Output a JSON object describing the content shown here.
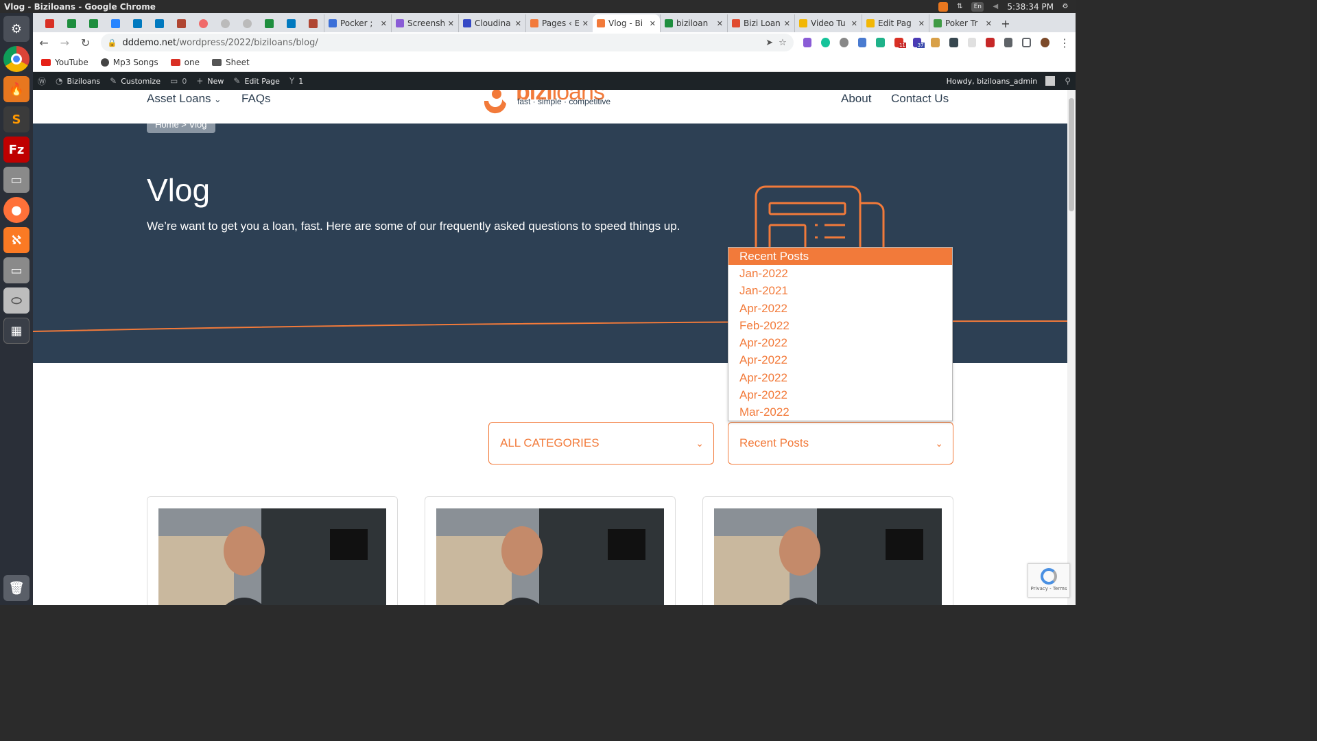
{
  "system_bar": {
    "window_title": "Vlog - Biziloans - Google Chrome",
    "keyboard_layout": "En",
    "clock": "5:38:34 PM"
  },
  "browser": {
    "tabs": [
      {
        "title": "Pocker ;",
        "color": "#3b6fd8"
      },
      {
        "title": "Screensh",
        "color": "#8a5cd6"
      },
      {
        "title": "Cloudina",
        "color": "#3448c5"
      },
      {
        "title": "Pages ‹ E",
        "color": "#f27a3a"
      },
      {
        "title": "Vlog - Bi",
        "color": "#f27a3a",
        "active": true
      },
      {
        "title": "biziloan",
        "color": "#1e8e3e"
      },
      {
        "title": "Bizi Loan",
        "color": "#e04a2e"
      },
      {
        "title": "Video Tu",
        "color": "#f2b705"
      },
      {
        "title": "Edit Pag",
        "color": "#f2b705"
      },
      {
        "title": "Poker Tr",
        "color": "#3f9b45"
      }
    ],
    "url_host": "dddemo.net",
    "url_path": "/wordpress/2022/biziloans/blog/",
    "bookmarks": [
      {
        "label": "YouTube",
        "color": "#e62117"
      },
      {
        "label": "Mp3 Songs",
        "color": "#444444"
      },
      {
        "label": "one",
        "color": "#d93025"
      },
      {
        "label": "Sheet",
        "color": "#555555"
      }
    ],
    "badge_mail": "11",
    "badge_other": "37"
  },
  "wp_admin": {
    "site": "Biziloans",
    "customize": "Customize",
    "comments": "0",
    "new": "New",
    "edit_page": "Edit Page",
    "yoast_count": "1",
    "howdy": "Howdy, biziloans_admin"
  },
  "site_nav": {
    "asset_loans": "Asset Loans",
    "faqs": "FAQs",
    "about": "About",
    "contact": "Contact Us",
    "logo_word_1": "bizi",
    "logo_word_2": "loans",
    "logo_tagline": "fast · simple · competitive"
  },
  "hero": {
    "breadcrumb": "Home > Vlog",
    "title": "Vlog",
    "description": "We’re want to get you a loan, fast. Here are some of our frequently asked questions to speed things up."
  },
  "dropdown": {
    "header": "Recent Posts",
    "options": [
      "Jan-2022",
      "Jan-2021",
      "Apr-2022",
      "Feb-2022",
      "Apr-2022",
      "Apr-2022",
      "Apr-2022",
      "Apr-2022",
      "Mar-2022"
    ]
  },
  "filters": {
    "categories": "ALL CATEGORIES",
    "recent": "Recent Posts"
  },
  "recaptcha": {
    "label": "Privacy - Terms"
  },
  "colors": {
    "accent": "#f27a3a",
    "hero_bg": "#2d4054",
    "wp_bar": "#1d2327"
  }
}
